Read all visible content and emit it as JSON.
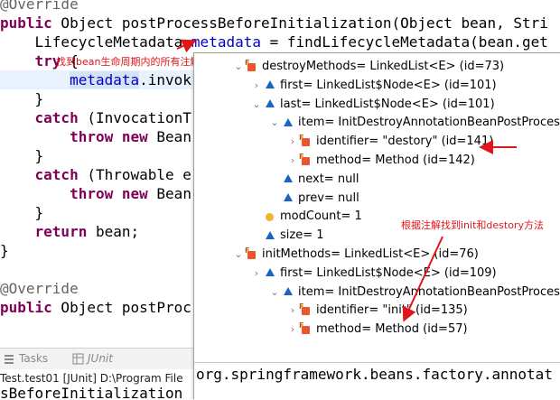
{
  "editor": {
    "lines": [
      {
        "id": "l0",
        "parts": [
          {
            "t": "@Override",
            "c": "ann"
          }
        ]
      },
      {
        "id": "l1",
        "parts": [
          {
            "t": "public",
            "c": "kw"
          },
          {
            "t": " Object postProcessBeforeInitialization(Object bean, Stri",
            "c": ""
          }
        ]
      },
      {
        "id": "l2",
        "parts": [
          {
            "t": "    LifecycleMetadata ",
            "c": ""
          },
          {
            "t": "metadata",
            "c": "var"
          },
          {
            "t": " = findLifecycleMetadata(bean.get",
            "c": ""
          }
        ]
      },
      {
        "id": "l3",
        "parts": [
          {
            "t": "    ",
            "c": ""
          },
          {
            "t": "try",
            "c": "kw"
          },
          {
            "t": " {",
            "c": ""
          }
        ]
      },
      {
        "id": "l4",
        "parts": [
          {
            "t": "        ",
            "c": ""
          },
          {
            "t": "metadata",
            "c": "hl"
          },
          {
            "t": ".invok",
            "c": ""
          }
        ]
      },
      {
        "id": "l5",
        "parts": [
          {
            "t": "    }",
            "c": ""
          }
        ]
      },
      {
        "id": "l6",
        "parts": [
          {
            "t": "    ",
            "c": ""
          },
          {
            "t": "catch",
            "c": "kw"
          },
          {
            "t": " (InvocationT",
            "c": ""
          }
        ]
      },
      {
        "id": "l7",
        "parts": [
          {
            "t": "        ",
            "c": ""
          },
          {
            "t": "throw",
            "c": "kw"
          },
          {
            "t": " ",
            "c": ""
          },
          {
            "t": "new",
            "c": "kw"
          },
          {
            "t": " Bean",
            "c": ""
          }
        ]
      },
      {
        "id": "l8",
        "parts": [
          {
            "t": "    }",
            "c": ""
          }
        ]
      },
      {
        "id": "l9",
        "parts": [
          {
            "t": "    ",
            "c": ""
          },
          {
            "t": "catch",
            "c": "kw"
          },
          {
            "t": " (Throwable e",
            "c": ""
          }
        ]
      },
      {
        "id": "l10",
        "parts": [
          {
            "t": "        ",
            "c": ""
          },
          {
            "t": "throw",
            "c": "kw"
          },
          {
            "t": " ",
            "c": ""
          },
          {
            "t": "new",
            "c": "kw"
          },
          {
            "t": " Bean",
            "c": ""
          }
        ]
      },
      {
        "id": "l11",
        "parts": [
          {
            "t": "    }",
            "c": ""
          }
        ]
      },
      {
        "id": "l12",
        "parts": [
          {
            "t": "    ",
            "c": ""
          },
          {
            "t": "return",
            "c": "kw"
          },
          {
            "t": " bean;",
            "c": ""
          }
        ]
      },
      {
        "id": "l13",
        "parts": [
          {
            "t": "}",
            "c": ""
          }
        ]
      },
      {
        "id": "l14",
        "parts": [
          {
            "t": "",
            "c": ""
          }
        ]
      },
      {
        "id": "l15",
        "parts": [
          {
            "t": "@Override",
            "c": "ann"
          }
        ]
      },
      {
        "id": "l16",
        "parts": [
          {
            "t": "public",
            "c": "kw"
          },
          {
            "t": " Object postProc",
            "c": ""
          }
        ]
      }
    ],
    "note": "找到bean生命周期内的所有注解"
  },
  "views_bar": {
    "tasks_label": "Tasks",
    "junit_label": "JUnit"
  },
  "console": {
    "run_label": "Test.test01 [JUnit] D:\\Program File",
    "cut_code": "sBeforeInitialization"
  },
  "popup": {
    "rows": [
      {
        "id": "r0",
        "indent": 0,
        "chev": "⌄",
        "icon": "field-final",
        "text": "destroyMethods= LinkedList<E>  (id=73)"
      },
      {
        "id": "r1",
        "indent": 1,
        "chev": "›",
        "icon": "triangle",
        "text": "first= LinkedList$Node<E>  (id=101)"
      },
      {
        "id": "r2",
        "indent": 1,
        "chev": "⌄",
        "icon": "triangle",
        "text": "last= LinkedList$Node<E>  (id=101)"
      },
      {
        "id": "r3",
        "indent": 2,
        "chev": "⌄",
        "icon": "triangle",
        "text": "item= InitDestroyAnnotationBeanPostProcesso"
      },
      {
        "id": "r4",
        "indent": 3,
        "chev": "›",
        "icon": "field-final",
        "text": "identifier= \"destory\" (id=141)"
      },
      {
        "id": "r5",
        "indent": 3,
        "chev": "›",
        "icon": "field-final",
        "text": "method= Method  (id=142)"
      },
      {
        "id": "r6",
        "indent": 2,
        "chev": "",
        "icon": "triangle",
        "text": "next= null"
      },
      {
        "id": "r7",
        "indent": 2,
        "chev": "",
        "icon": "triangle",
        "text": "prev= null"
      },
      {
        "id": "r8",
        "indent": 1,
        "chev": "",
        "icon": "dot",
        "text": "modCount= 1"
      },
      {
        "id": "r9",
        "indent": 1,
        "chev": "",
        "icon": "triangle",
        "text": "size= 1"
      },
      {
        "id": "r10",
        "indent": 0,
        "chev": "⌄",
        "icon": "field-final",
        "text": "initMethods= LinkedList<E>  (id=76)"
      },
      {
        "id": "r11",
        "indent": 1,
        "chev": "›",
        "icon": "triangle",
        "text": "first= LinkedList$Node<E>  (id=109)"
      },
      {
        "id": "r12",
        "indent": 2,
        "chev": "⌄",
        "icon": "triangle",
        "text": "item= InitDestroyAnnotationBeanPostProcesso"
      },
      {
        "id": "r13",
        "indent": 3,
        "chev": "›",
        "icon": "field-final",
        "text": "identifier= \"init\" (id=135)"
      },
      {
        "id": "r14",
        "indent": 3,
        "chev": "›",
        "icon": "field-final",
        "text": "method= Method  (id=57)"
      }
    ],
    "value_text": "org.springframework.beans.factory.annotat",
    "note": "根据注解找到init和destory方法"
  },
  "colors": {
    "keyword": "#7f0055",
    "annotation_note": "#e0161a",
    "field_icon": "#e8582a",
    "triangle_icon": "#1a64c8"
  }
}
